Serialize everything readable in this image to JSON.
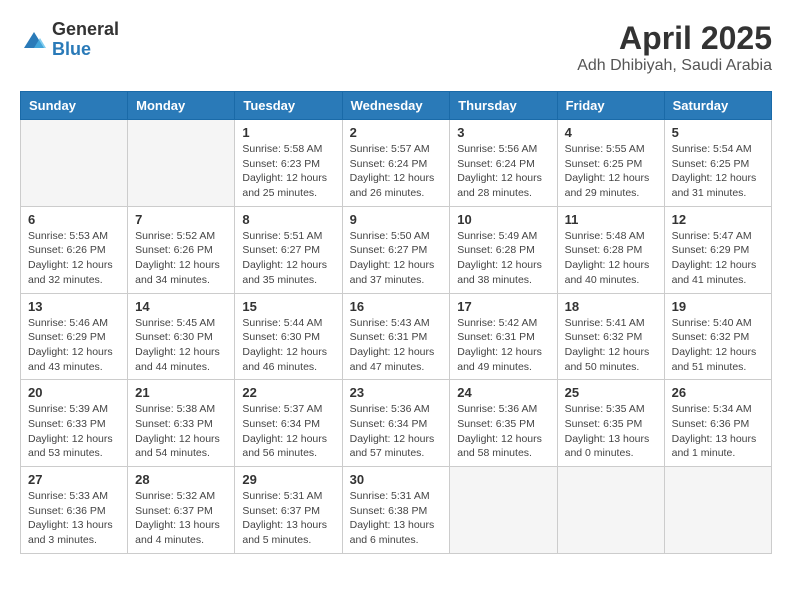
{
  "logo": {
    "general": "General",
    "blue": "Blue"
  },
  "title": "April 2025",
  "location": "Adh Dhibiyah, Saudi Arabia",
  "weekdays": [
    "Sunday",
    "Monday",
    "Tuesday",
    "Wednesday",
    "Thursday",
    "Friday",
    "Saturday"
  ],
  "weeks": [
    [
      {
        "day": "",
        "empty": true
      },
      {
        "day": "",
        "empty": true
      },
      {
        "day": "1",
        "sunrise": "5:58 AM",
        "sunset": "6:23 PM",
        "daylight": "12 hours and 25 minutes."
      },
      {
        "day": "2",
        "sunrise": "5:57 AM",
        "sunset": "6:24 PM",
        "daylight": "12 hours and 26 minutes."
      },
      {
        "day": "3",
        "sunrise": "5:56 AM",
        "sunset": "6:24 PM",
        "daylight": "12 hours and 28 minutes."
      },
      {
        "day": "4",
        "sunrise": "5:55 AM",
        "sunset": "6:25 PM",
        "daylight": "12 hours and 29 minutes."
      },
      {
        "day": "5",
        "sunrise": "5:54 AM",
        "sunset": "6:25 PM",
        "daylight": "12 hours and 31 minutes."
      }
    ],
    [
      {
        "day": "6",
        "sunrise": "5:53 AM",
        "sunset": "6:26 PM",
        "daylight": "12 hours and 32 minutes."
      },
      {
        "day": "7",
        "sunrise": "5:52 AM",
        "sunset": "6:26 PM",
        "daylight": "12 hours and 34 minutes."
      },
      {
        "day": "8",
        "sunrise": "5:51 AM",
        "sunset": "6:27 PM",
        "daylight": "12 hours and 35 minutes."
      },
      {
        "day": "9",
        "sunrise": "5:50 AM",
        "sunset": "6:27 PM",
        "daylight": "12 hours and 37 minutes."
      },
      {
        "day": "10",
        "sunrise": "5:49 AM",
        "sunset": "6:28 PM",
        "daylight": "12 hours and 38 minutes."
      },
      {
        "day": "11",
        "sunrise": "5:48 AM",
        "sunset": "6:28 PM",
        "daylight": "12 hours and 40 minutes."
      },
      {
        "day": "12",
        "sunrise": "5:47 AM",
        "sunset": "6:29 PM",
        "daylight": "12 hours and 41 minutes."
      }
    ],
    [
      {
        "day": "13",
        "sunrise": "5:46 AM",
        "sunset": "6:29 PM",
        "daylight": "12 hours and 43 minutes."
      },
      {
        "day": "14",
        "sunrise": "5:45 AM",
        "sunset": "6:30 PM",
        "daylight": "12 hours and 44 minutes."
      },
      {
        "day": "15",
        "sunrise": "5:44 AM",
        "sunset": "6:30 PM",
        "daylight": "12 hours and 46 minutes."
      },
      {
        "day": "16",
        "sunrise": "5:43 AM",
        "sunset": "6:31 PM",
        "daylight": "12 hours and 47 minutes."
      },
      {
        "day": "17",
        "sunrise": "5:42 AM",
        "sunset": "6:31 PM",
        "daylight": "12 hours and 49 minutes."
      },
      {
        "day": "18",
        "sunrise": "5:41 AM",
        "sunset": "6:32 PM",
        "daylight": "12 hours and 50 minutes."
      },
      {
        "day": "19",
        "sunrise": "5:40 AM",
        "sunset": "6:32 PM",
        "daylight": "12 hours and 51 minutes."
      }
    ],
    [
      {
        "day": "20",
        "sunrise": "5:39 AM",
        "sunset": "6:33 PM",
        "daylight": "12 hours and 53 minutes."
      },
      {
        "day": "21",
        "sunrise": "5:38 AM",
        "sunset": "6:33 PM",
        "daylight": "12 hours and 54 minutes."
      },
      {
        "day": "22",
        "sunrise": "5:37 AM",
        "sunset": "6:34 PM",
        "daylight": "12 hours and 56 minutes."
      },
      {
        "day": "23",
        "sunrise": "5:36 AM",
        "sunset": "6:34 PM",
        "daylight": "12 hours and 57 minutes."
      },
      {
        "day": "24",
        "sunrise": "5:36 AM",
        "sunset": "6:35 PM",
        "daylight": "12 hours and 58 minutes."
      },
      {
        "day": "25",
        "sunrise": "5:35 AM",
        "sunset": "6:35 PM",
        "daylight": "13 hours and 0 minutes."
      },
      {
        "day": "26",
        "sunrise": "5:34 AM",
        "sunset": "6:36 PM",
        "daylight": "13 hours and 1 minute."
      }
    ],
    [
      {
        "day": "27",
        "sunrise": "5:33 AM",
        "sunset": "6:36 PM",
        "daylight": "13 hours and 3 minutes."
      },
      {
        "day": "28",
        "sunrise": "5:32 AM",
        "sunset": "6:37 PM",
        "daylight": "13 hours and 4 minutes."
      },
      {
        "day": "29",
        "sunrise": "5:31 AM",
        "sunset": "6:37 PM",
        "daylight": "13 hours and 5 minutes."
      },
      {
        "day": "30",
        "sunrise": "5:31 AM",
        "sunset": "6:38 PM",
        "daylight": "13 hours and 6 minutes."
      },
      {
        "day": "",
        "empty": true
      },
      {
        "day": "",
        "empty": true
      },
      {
        "day": "",
        "empty": true
      }
    ]
  ],
  "labels": {
    "sunrise": "Sunrise:",
    "sunset": "Sunset:",
    "daylight": "Daylight:"
  }
}
